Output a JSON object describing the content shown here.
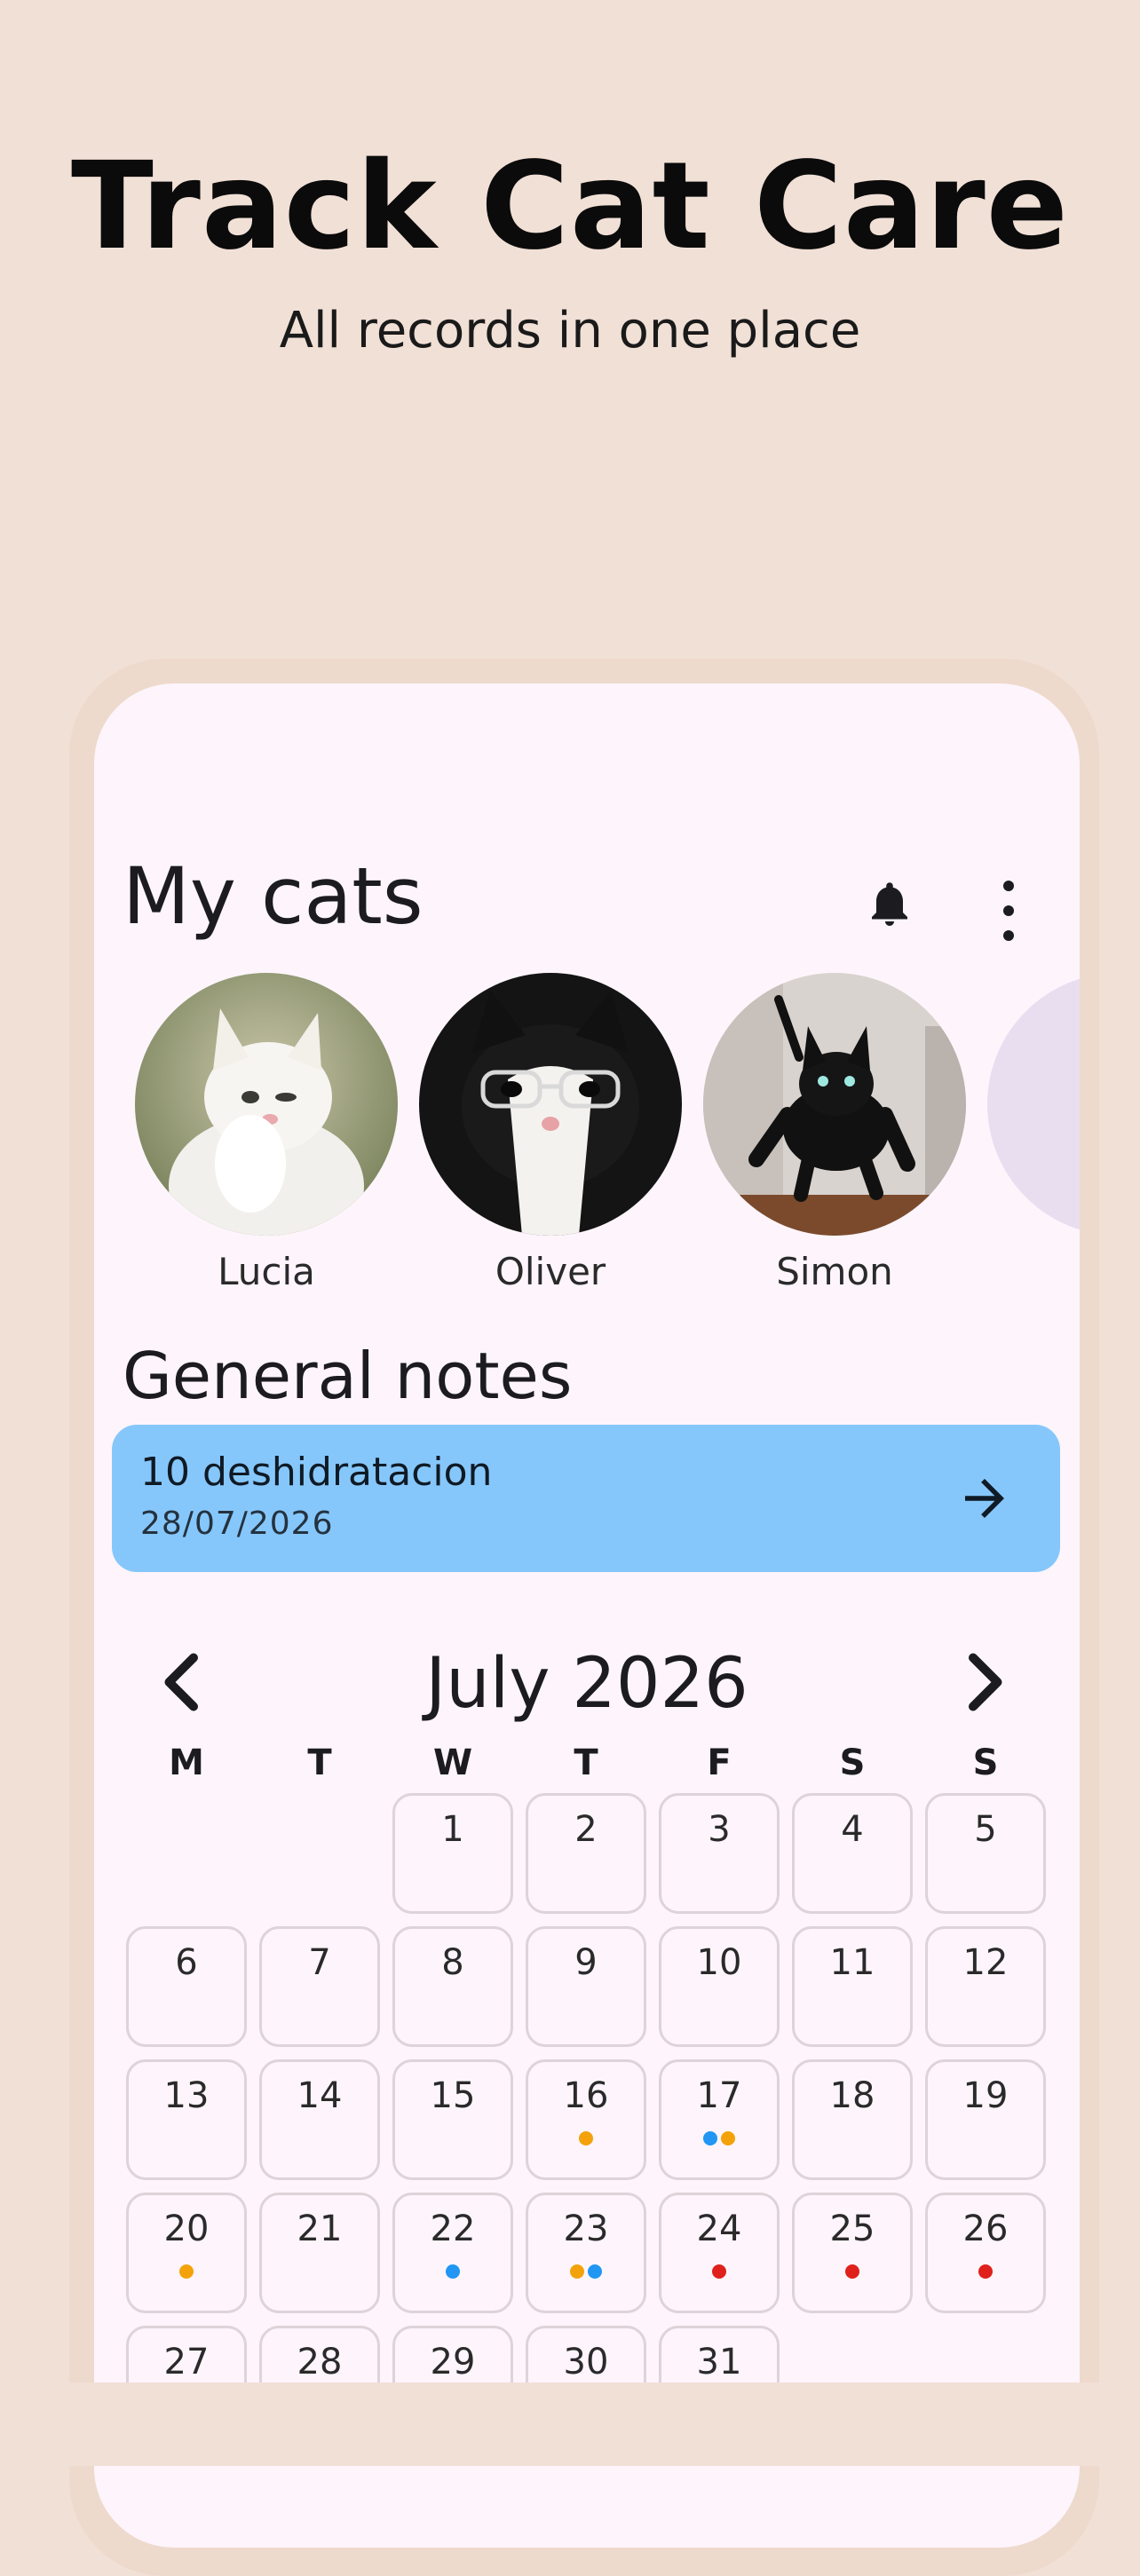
{
  "hero": {
    "title": "Track Cat Care",
    "subtitle": "All records in one place"
  },
  "header": {
    "title": "My cats",
    "bell_icon": "bell-icon",
    "menu_icon": "more-vert-icon"
  },
  "cats": [
    {
      "name": "Lucia"
    },
    {
      "name": "Oliver"
    },
    {
      "name": "Simon"
    }
  ],
  "notes": {
    "title": "General notes",
    "items": [
      {
        "title": "10 deshidratacion",
        "date": "28/07/2026"
      }
    ]
  },
  "calendar": {
    "title": "July 2026",
    "weekdays": [
      "M",
      "T",
      "W",
      "T",
      "F",
      "S",
      "S"
    ],
    "first_weekday_index": 2,
    "days": [
      {
        "day": "1",
        "dots": []
      },
      {
        "day": "2",
        "dots": []
      },
      {
        "day": "3",
        "dots": []
      },
      {
        "day": "4",
        "dots": []
      },
      {
        "day": "5",
        "dots": []
      },
      {
        "day": "6",
        "dots": []
      },
      {
        "day": "7",
        "dots": []
      },
      {
        "day": "8",
        "dots": []
      },
      {
        "day": "9",
        "dots": []
      },
      {
        "day": "10",
        "dots": []
      },
      {
        "day": "11",
        "dots": []
      },
      {
        "day": "12",
        "dots": []
      },
      {
        "day": "13",
        "dots": []
      },
      {
        "day": "14",
        "dots": []
      },
      {
        "day": "15",
        "dots": []
      },
      {
        "day": "16",
        "dots": [
          "#f4a20c"
        ]
      },
      {
        "day": "17",
        "dots": [
          "#2196f3",
          "#f4a20c"
        ]
      },
      {
        "day": "18",
        "dots": []
      },
      {
        "day": "19",
        "dots": []
      },
      {
        "day": "20",
        "dots": [
          "#f4a20c"
        ]
      },
      {
        "day": "21",
        "dots": []
      },
      {
        "day": "22",
        "dots": [
          "#2196f3"
        ]
      },
      {
        "day": "23",
        "dots": [
          "#f4a20c",
          "#2196f3"
        ]
      },
      {
        "day": "24",
        "dots": [
          "#e0201b"
        ]
      },
      {
        "day": "25",
        "dots": [
          "#e0201b"
        ]
      },
      {
        "day": "26",
        "dots": [
          "#e0201b"
        ]
      },
      {
        "day": "27",
        "dots": []
      },
      {
        "day": "28",
        "dots": []
      },
      {
        "day": "29",
        "dots": []
      },
      {
        "day": "30",
        "dots": []
      },
      {
        "day": "31",
        "dots": []
      }
    ]
  },
  "colors": {
    "background": "#f1e0d6",
    "phone_surface": "#fdf5fb",
    "note_card": "#86c7fb",
    "dot_orange": "#f4a20c",
    "dot_blue": "#2196f3",
    "dot_red": "#e0201b"
  }
}
